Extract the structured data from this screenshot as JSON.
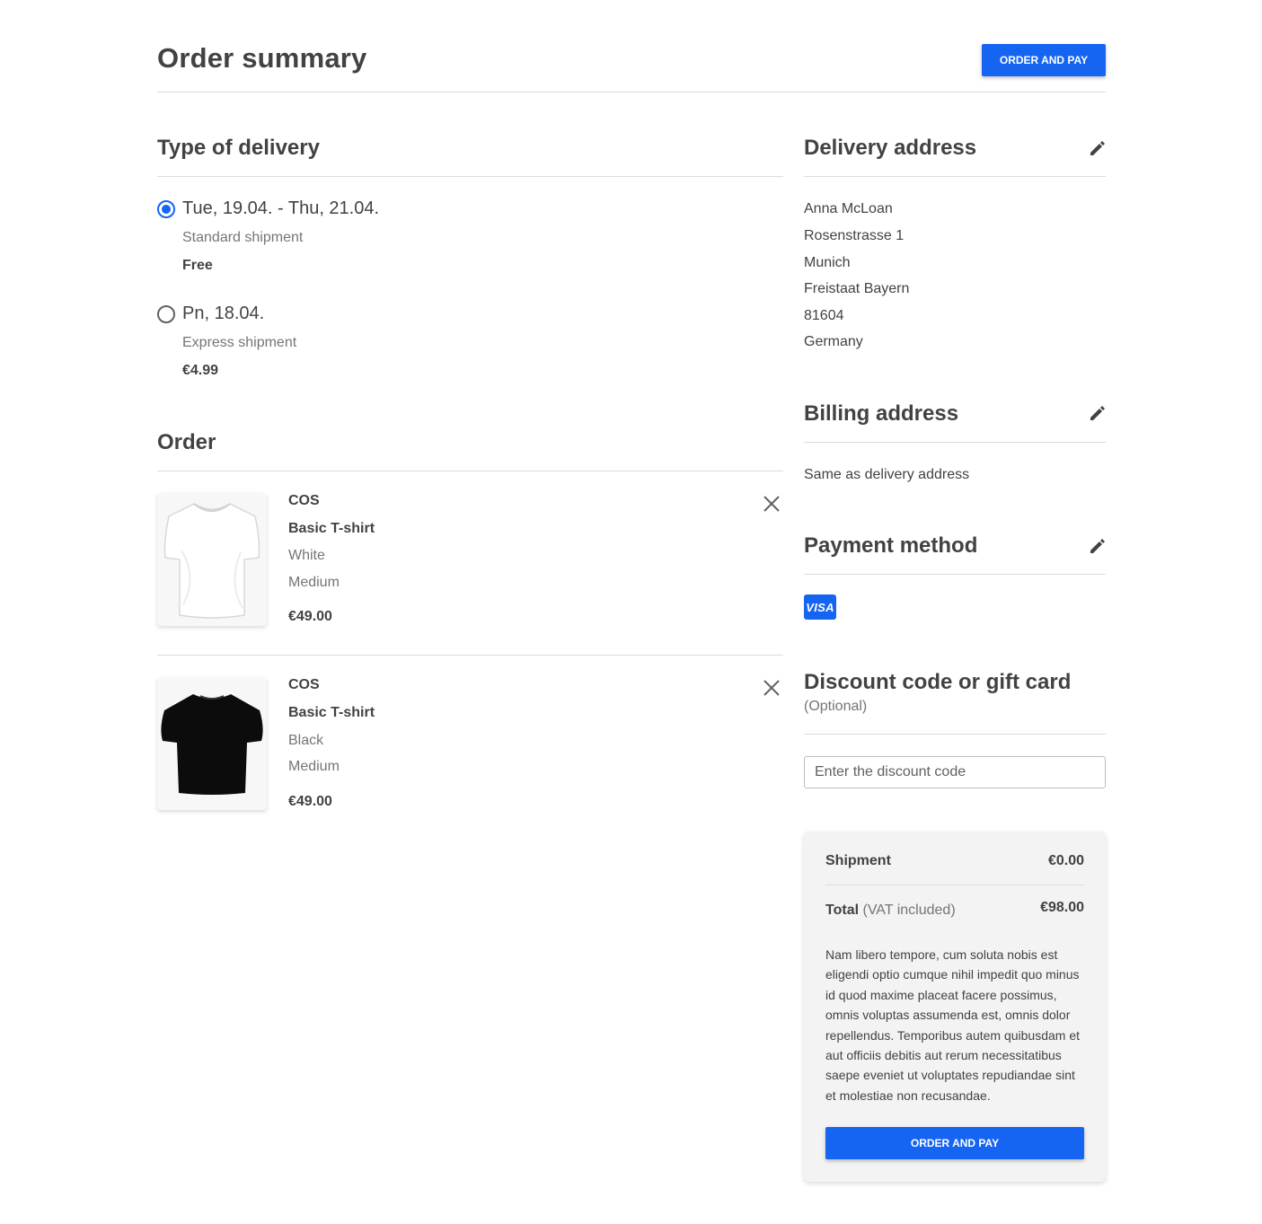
{
  "header": {
    "title": "Order summary",
    "order_button": "ORDER AND PAY"
  },
  "delivery": {
    "title": "Type of delivery",
    "options": [
      {
        "date": "Tue, 19.04. - Thu, 21.04.",
        "type": "Standard shipment",
        "price": "Free",
        "selected": true
      },
      {
        "date": "Pn, 18.04.",
        "type": "Express shipment",
        "price": "€4.99",
        "selected": false
      }
    ]
  },
  "order": {
    "title": "Order",
    "items": [
      {
        "brand": "COS",
        "name": "Basic T-shirt",
        "color": "White",
        "size": "Medium",
        "price": "€49.00",
        "image": "white-tshirt"
      },
      {
        "brand": "COS",
        "name": "Basic T-shirt",
        "color": "Black",
        "size": "Medium",
        "price": "€49.00",
        "image": "black-tshirt"
      }
    ]
  },
  "delivery_address": {
    "title": "Delivery address",
    "lines": [
      "Anna McLoan",
      "Rosenstrasse 1",
      "Munich",
      "Freistaat Bayern",
      "81604",
      "Germany"
    ]
  },
  "billing_address": {
    "title": "Billing address",
    "text": "Same as delivery address"
  },
  "payment": {
    "title": "Payment method",
    "card_label": "VISA",
    "card_color": "#1565f2"
  },
  "discount": {
    "title": "Discount code or gift card",
    "optional": "(Optional)",
    "placeholder": "Enter the discount code"
  },
  "summary": {
    "shipment_label": "Shipment",
    "shipment_value": "€0.00",
    "total_label": "Total",
    "total_note": "(VAT included)",
    "total_value": "€98.00",
    "note": "Nam libero tempore, cum soluta nobis est eligendi optio cumque nihil impedit quo minus id quod maxime placeat facere possimus, omnis voluptas assumenda est, omnis dolor repellendus. Temporibus autem quibusdam et aut officiis debitis aut rerum necessitatibus saepe eveniet ut voluptates repudiandae sint et molestiae non recusandae.",
    "order_button": "ORDER AND PAY"
  },
  "colors": {
    "accent": "#1565f2",
    "text": "#424242",
    "muted": "#757575"
  }
}
